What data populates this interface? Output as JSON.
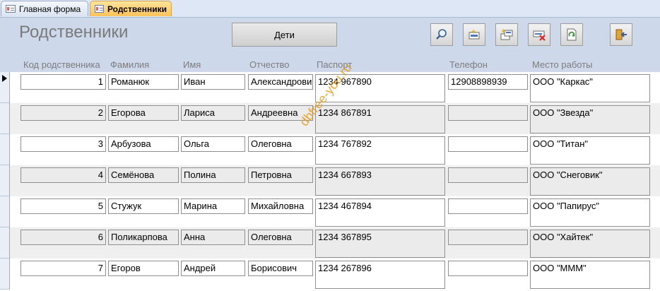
{
  "tabs": [
    {
      "label": "Главная форма",
      "active": false
    },
    {
      "label": "Родственники",
      "active": true
    }
  ],
  "form": {
    "title": "Родственники",
    "children_button": "Дети",
    "toolbar_icons": [
      "search-icon",
      "new-record-icon",
      "copy-record-icon",
      "delete-record-icon",
      "refresh-icon",
      "exit-icon"
    ]
  },
  "columns": {
    "code": "Код родственника",
    "surname": "Фамилия",
    "name": "Имя",
    "patronymic": "Отчество",
    "passport": "Паспорт",
    "phone": "Телефон",
    "workplace": "Место работы"
  },
  "rows": [
    {
      "code": "1",
      "surname": "Романюк",
      "name": "Иван",
      "patronymic": "Александрови",
      "passport": "1234 967890",
      "phone": "12908898939",
      "workplace": "ООО \"Каркас\""
    },
    {
      "code": "2",
      "surname": "Егорова",
      "name": "Лариса",
      "patronymic": "Андреевна",
      "passport": "1234 867891",
      "phone": "",
      "workplace": "ООО \"Звезда\""
    },
    {
      "code": "3",
      "surname": "Арбузова",
      "name": "Ольга",
      "patronymic": "Олеговна",
      "passport": "1234 767892",
      "phone": "",
      "workplace": "ООО \"Титан\""
    },
    {
      "code": "4",
      "surname": "Семёнова",
      "name": "Полина",
      "patronymic": "Петровна",
      "passport": "1234 667893",
      "phone": "",
      "workplace": "ООО \"Снеговик\""
    },
    {
      "code": "5",
      "surname": "Стужук",
      "name": "Марина",
      "patronymic": "Михайловна",
      "passport": "1234 467894",
      "phone": "",
      "workplace": "ООО \"Папирус\""
    },
    {
      "code": "6",
      "surname": "Поликарпова",
      "name": "Анна",
      "patronymic": "Олеговна",
      "passport": "1234 367895",
      "phone": "",
      "workplace": "ООО \"Хайтек\""
    },
    {
      "code": "7",
      "surname": "Егоров",
      "name": "Андрей",
      "patronymic": "Борисович",
      "passport": "1234 267896",
      "phone": "",
      "workplace": "ООО \"МММ\""
    }
  ],
  "watermark": "dbfree-you.ru",
  "colors": {
    "header_bg": "#cdd8ea",
    "active_tab": "#ffc35a",
    "alt_row": "#efefef",
    "watermark": "#e69a1a"
  }
}
